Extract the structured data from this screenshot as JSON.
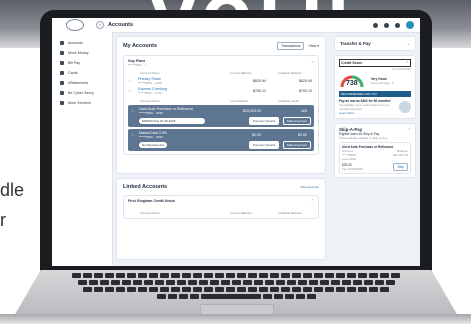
{
  "page_text": {
    "left_line_1": "dle",
    "left_line_2": "r"
  },
  "topbar": {
    "title": "Accounts",
    "collapse_glyph": "«"
  },
  "nav": {
    "items": [
      {
        "label": "Accounts",
        "icon": "home-icon"
      },
      {
        "label": "Move Money",
        "icon": "transfer-icon"
      },
      {
        "label": "Bill Pay",
        "icon": "bill-icon"
      },
      {
        "label": "Cards",
        "icon": "card-icon"
      },
      {
        "label": "eStatements",
        "icon": "statement-icon"
      },
      {
        "label": "Be Cyber Savvy",
        "icon": "shield-icon"
      },
      {
        "label": "More Services",
        "icon": "more-icon"
      }
    ]
  },
  "my_accounts": {
    "title": "My Accounts",
    "transactions_btn": "Transactions",
    "view_label": "View ▾",
    "institution": "Guy Plant",
    "institution_mask": "******0000 · ⓘ",
    "headers": {
      "name": "Account Name",
      "current": "Current Balance",
      "available": "Available Balance"
    },
    "deposit_rows": [
      {
        "name": "Primary Share",
        "mask": "******0000 – 1000",
        "current": "$620.94",
        "available": "$620.94"
      },
      {
        "name": "Express Checking",
        "mask": "******0000 – 1760",
        "current": "$700.12",
        "available": "$700.12"
      }
    ],
    "loan_headers": {
      "name": "Account Name",
      "current": "Loan Balance",
      "available": "Available Credit"
    },
    "loans": [
      {
        "name": "Used Auto Purchase or Refinance",
        "mask": "******0000 – 4030",
        "current": "$33,000.00",
        "available": "N/A",
        "pill": "$208.50 Due 07-20-2025",
        "pay_label": "Payment Details",
        "make_label": "Make Payment"
      },
      {
        "name": "MasterCard 3.9%",
        "mask": "******0000 – 4050",
        "current": "$0.00",
        "available": "$0.00",
        "pill": "No Payment due",
        "pay_label": "Payment Details",
        "make_label": "Make Payment"
      }
    ]
  },
  "linked": {
    "title": "Linked Accounts",
    "hide_link": "hide Accounts",
    "institution": "First Gingham Credit Union",
    "headers": {
      "name": "Account Name",
      "current": "Current Balance",
      "available": "Available Balance"
    }
  },
  "transfer_pay": {
    "title": "Transfer & Pay"
  },
  "credit": {
    "title": "Credit Score",
    "date": "as of 07/09/25",
    "score": "738",
    "rating": "Very Good",
    "change": "Score Change",
    "change_val": "0",
    "recommend": "RECOMMENDED FOR YOU",
    "offer": "Pay as low as $462 for 60 months!",
    "note": "Consolidate your credit cards into one monthly payment",
    "learn": "Learn More"
  },
  "skip": {
    "title": "Skip-A-Pay",
    "eligible": "Eligible loans for Skip-A-Pay",
    "sub": "Total available eligible to Skip-A-Pay",
    "loan_name": "Used Auto Purchase or Refinance",
    "acct_label": "Account",
    "acct_val": "******0000",
    "loan_bal_label": "Loan 4030",
    "balance_label": "Balance",
    "balance_val": "$33,000.00",
    "fee": "$30.00",
    "fee_label": "Fee 07/09/2025",
    "skip_btn": "Skip"
  }
}
